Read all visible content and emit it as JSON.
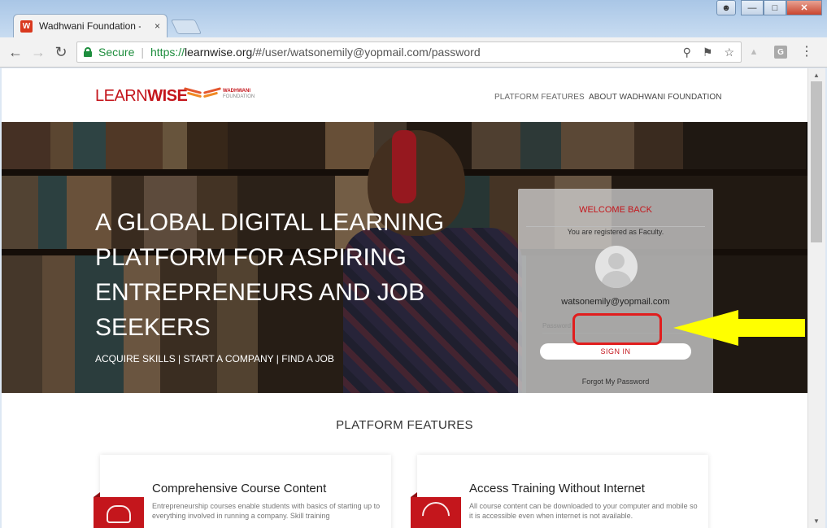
{
  "browser": {
    "tab_title": "Wadhwani Foundation -",
    "tab_favicon_letter": "W",
    "tab_close": "×",
    "secure_label": "Secure",
    "url_protocol": "https://",
    "url_host": "learnwise.org",
    "url_path": "/#/user/watsonemily@yopmail.com/password",
    "ext_g_letter": "G"
  },
  "site": {
    "logo_learn": "LEARN",
    "logo_wise": "WISE",
    "logo_wadhwani": "WADHWANI",
    "logo_foundation": "FOUNDATION",
    "nav": [
      "PLATFORM FEATURES",
      "ABOUT WADHWANI FOUNDATION"
    ]
  },
  "hero": {
    "title": "A GLOBAL DIGITAL LEARNING PLATFORM FOR ASPIRING ENTREPRENEURS AND JOB SEEKERS",
    "subtitle": "ACQUIRE SKILLS | START A COMPANY | FIND A JOB"
  },
  "login": {
    "heading": "WELCOME BACK",
    "registered_text": "You are registered as Faculty.",
    "email": "watsonemily@yopmail.com",
    "password_placeholder": "Password",
    "signin_label": "SIGN IN",
    "forgot_label": "Forgot My Password"
  },
  "features": {
    "heading": "PLATFORM FEATURES",
    "cards": [
      {
        "title": "Comprehensive Course Content",
        "desc": "Entrepreneurship courses enable students with basics of starting up to everything involved in running a company. Skill training"
      },
      {
        "title": "Access Training Without Internet",
        "desc": "All course content can be downloaded to your computer and mobile so it is accessible even when internet is not available."
      }
    ]
  },
  "colors": {
    "brand_red": "#c4161c",
    "secure_green": "#1e8e3e",
    "annotation_yellow": "#ffff00",
    "annotation_ring": "#e11d1d"
  }
}
